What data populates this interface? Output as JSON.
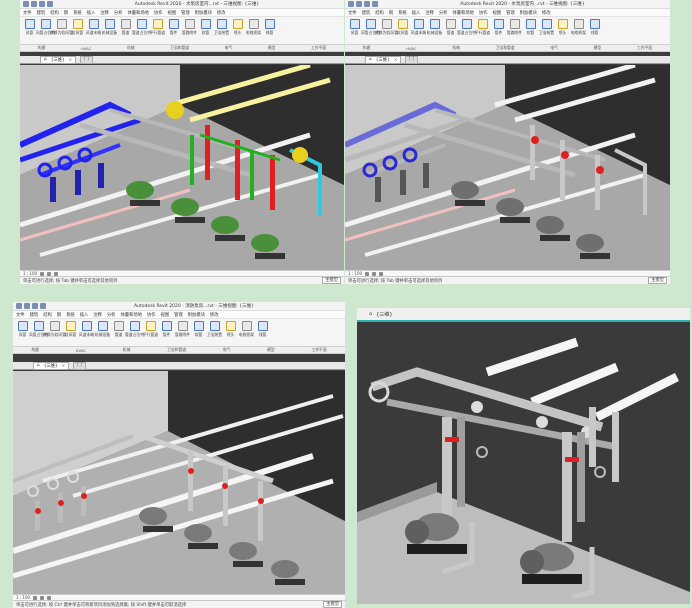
{
  "panels": [
    {
      "id": "p1",
      "title": "Autodesk Revit 2020 - 水泵房室内...rvt - 三维视图: {三维}",
      "menu": [
        "文件",
        "建筑",
        "结构",
        "钢",
        "系统",
        "插入",
        "注释",
        "分析",
        "体量和场地",
        "协作",
        "视图",
        "管理",
        "附加模块",
        "修改"
      ],
      "tools": [
        "风管",
        "风管占位符",
        "转换为软风管",
        "软风管",
        "风道末端",
        "机械设备",
        "管道",
        "管道占位符",
        "平行管道",
        "管件",
        "管路附件",
        "软管",
        "卫浴装置",
        "喷头",
        "电缆桥架",
        "线管"
      ],
      "groups": [
        "构建",
        "HVAC",
        "机械",
        "卫浴和管道",
        "电气",
        "模型",
        "工作平面"
      ],
      "view_tab": "{三维}",
      "view_tab2": "[ ]",
      "status_left": "单击可进行选择; 按 Tab 键并单击可选择其他项目",
      "status_field": "主模型",
      "scale": "1 : 100"
    },
    {
      "id": "p2",
      "title": "Autodesk Revit 2020 - 水泵房室内...rvt - 三维视图: {三维}",
      "menu": [
        "文件",
        "建筑",
        "结构",
        "钢",
        "系统",
        "插入",
        "注释",
        "分析",
        "体量和场地",
        "协作",
        "视图",
        "管理",
        "附加模块",
        "修改"
      ],
      "tools": [
        "风管",
        "风管占位符",
        "转换为软风管",
        "软风管",
        "风道末端",
        "机械设备",
        "管道",
        "管道占位符",
        "平行管道",
        "管件",
        "管路附件",
        "软管",
        "卫浴装置",
        "喷头",
        "电缆桥架",
        "线管"
      ],
      "groups": [
        "构建",
        "HVAC",
        "机械",
        "卫浴和管道",
        "电气",
        "模型",
        "工作平面"
      ],
      "view_tab": "{三维}",
      "view_tab2": "[ ]",
      "status_left": "单击可进行选择; 按 Tab 键并单击可选择其他项目",
      "status_field": "主模型",
      "scale": "1 : 100"
    },
    {
      "id": "p3",
      "title": "Autodesk Revit 2020 - 消防泵房...rvt - 三维视图: {三维}",
      "menu": [
        "文件",
        "建筑",
        "结构",
        "钢",
        "系统",
        "插入",
        "注释",
        "分析",
        "体量和场地",
        "协作",
        "视图",
        "管理",
        "附加模块",
        "修改"
      ],
      "tools": [
        "风管",
        "风管占位符",
        "转换为软风管",
        "软风管",
        "风道末端",
        "机械设备",
        "管道",
        "管道占位符",
        "平行管道",
        "管件",
        "管路附件",
        "软管",
        "卫浴装置",
        "喷头",
        "电缆桥架",
        "线管"
      ],
      "groups": [
        "构建",
        "HVAC",
        "机械",
        "卫浴和管道",
        "电气",
        "模型",
        "工作平面"
      ],
      "view_tab": "{三维}",
      "view_tab2": "[ ]",
      "status_left": "单击可进行选择; 按 Ctrl 键并单击可将新项目添加到选择集; 按 Shift 键并单击可取消选择",
      "status_field": "主模型",
      "scale": "1 : 100"
    },
    {
      "id": "p4",
      "view_tab": "{三维}"
    }
  ],
  "colors": {
    "background": "#cfe6cf",
    "cw_blue": "#2222ee",
    "hw_red": "#e02020",
    "green": "#20b020",
    "yellow": "#e8d020",
    "cyan": "#30c8e0",
    "white_pipe": "#f2f2f2",
    "grey_pipe": "#b8b8b8",
    "accent": "#2ab3b3"
  },
  "icons": [
    "save-icon",
    "undo-icon",
    "redo-icon",
    "close-icon",
    "cube-icon",
    "pump-icon",
    "valve-icon"
  ]
}
